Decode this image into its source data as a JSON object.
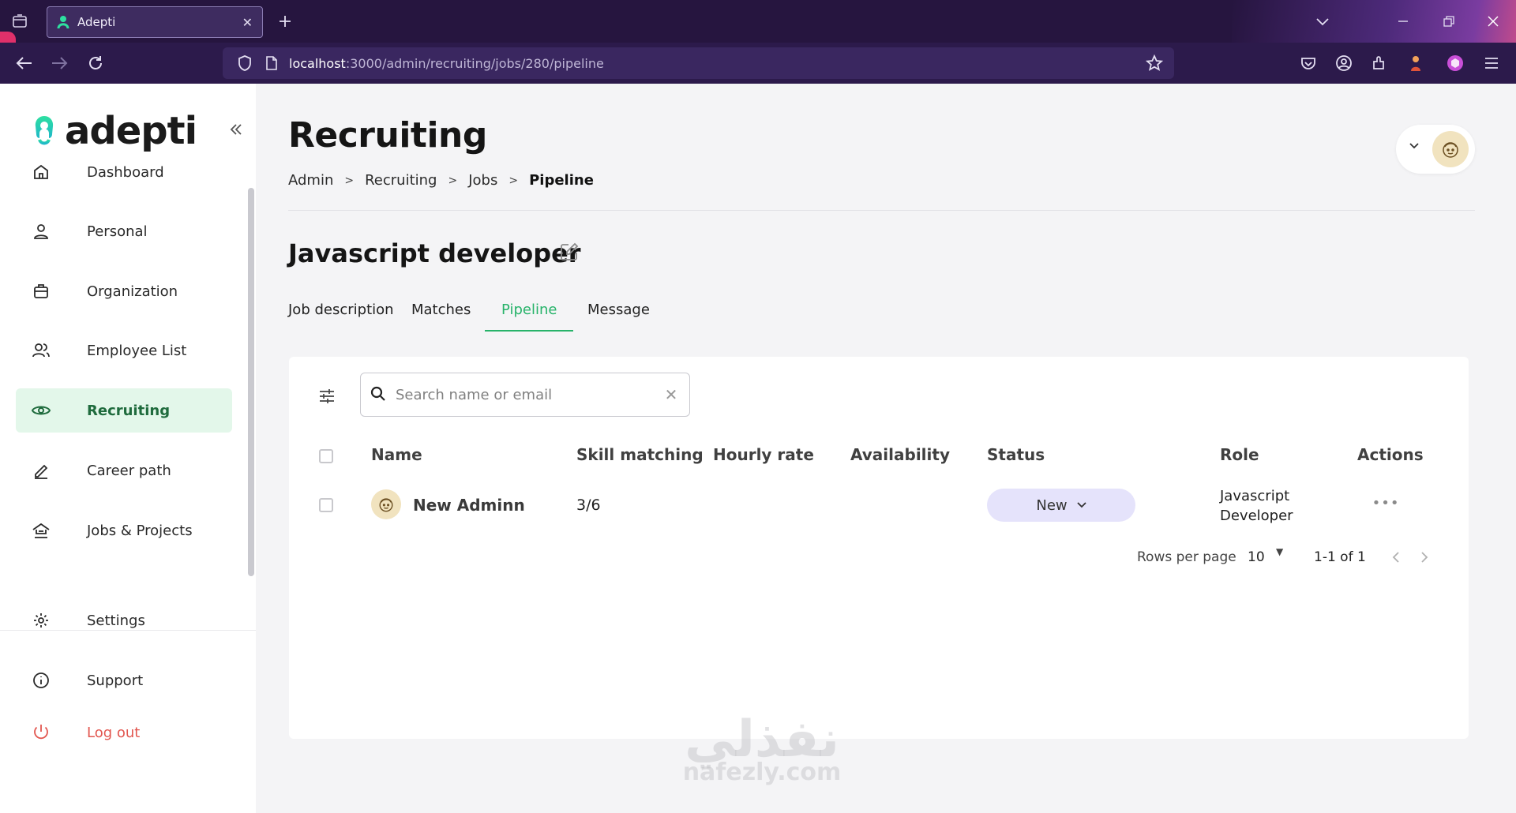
{
  "browser": {
    "tab_title": "Adepti",
    "url_host": "localhost",
    "url_path": ":3000/admin/recruiting/jobs/280/pipeline"
  },
  "sidebar": {
    "logo_text": "adepti",
    "items": [
      {
        "label": "Dashboard",
        "icon": "home-icon"
      },
      {
        "label": "Personal",
        "icon": "user-icon"
      },
      {
        "label": "Organization",
        "icon": "briefcase-icon"
      },
      {
        "label": "Employee List",
        "icon": "users-icon"
      },
      {
        "label": "Recruiting",
        "icon": "eye-icon",
        "active": true
      },
      {
        "label": "Career path",
        "icon": "pen-icon"
      },
      {
        "label": "Jobs & Projects",
        "icon": "jobs-icon"
      }
    ],
    "bottom_items": [
      {
        "label": "Settings",
        "icon": "gear-icon"
      },
      {
        "label": "Support",
        "icon": "info-icon"
      },
      {
        "label": "Log out",
        "icon": "power-icon"
      }
    ]
  },
  "header": {
    "title": "Recruiting",
    "breadcrumb": [
      "Admin",
      "Recruiting",
      "Jobs",
      "Pipeline"
    ]
  },
  "job": {
    "title": "Javascript developer",
    "tabs": [
      "Job description",
      "Matches",
      "Pipeline",
      "Message"
    ],
    "active_tab": "Pipeline"
  },
  "table": {
    "search_placeholder": "Search name or email",
    "columns": [
      "Name",
      "Skill matching",
      "Hourly rate",
      "Availability",
      "Status",
      "Role",
      "Actions"
    ],
    "rows": [
      {
        "name": "New Adminn",
        "skill_matching": "3/6",
        "hourly_rate": "",
        "availability": "",
        "status": "New",
        "role_line1": "Javascript",
        "role_line2": "Developer",
        "actions": "•••"
      }
    ],
    "pagination": {
      "rows_per_page_label": "Rows per page",
      "rows_per_page": "10",
      "range": "1-1 of 1"
    }
  },
  "watermark": {
    "arabic": "نفذلي",
    "latin": "nafezly.com"
  },
  "colors": {
    "accent_green": "#27b36a",
    "active_bg": "#e3f7ea",
    "status_pill": "#e5e3fb",
    "logout_red": "#e2564f",
    "browser_bg": "#26153f"
  }
}
